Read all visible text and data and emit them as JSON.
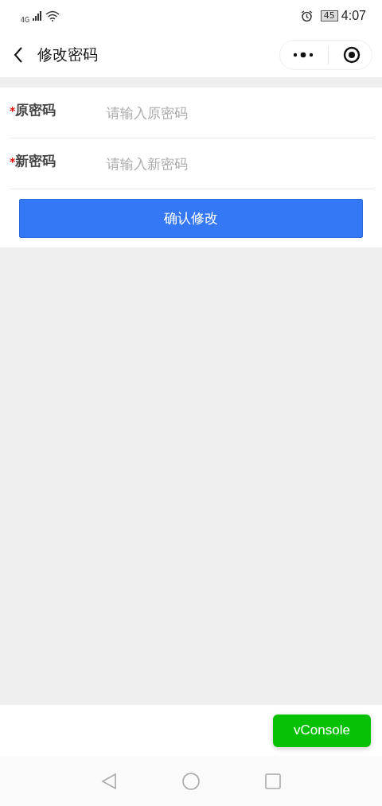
{
  "status_bar": {
    "network": "4G",
    "battery": "45",
    "time": "4:07"
  },
  "nav": {
    "title": "修改密码"
  },
  "fields": [
    {
      "mark": "*",
      "label": "原密码",
      "placeholder": "请输入原密码"
    },
    {
      "mark": "*",
      "label": "新密码",
      "placeholder": "请输入新密码"
    }
  ],
  "submit": "确认修改",
  "vconsole": "vConsole"
}
